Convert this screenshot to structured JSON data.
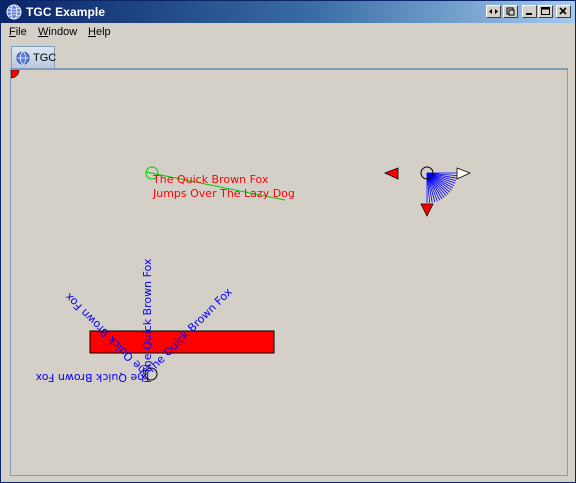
{
  "window": {
    "title": "TGC Example",
    "title_icon": "globe-icon"
  },
  "titlebar_buttons": [
    "pin-icon",
    "restore-small-icon",
    "minimize-icon",
    "maximize-icon",
    "close-icon"
  ],
  "menu": {
    "file": "File",
    "file_rest": "ile",
    "window": "Window",
    "window_rest": "indow",
    "help": "Help",
    "help_rest": "elp"
  },
  "tab": {
    "label": "TGC",
    "icon": "globe-icon"
  },
  "canvas": {
    "text1_line1": "The Quick Brown Fox",
    "text1_line2": "Jumps Over The Lazy Dog",
    "rotated_text": "The Quick Brown Fox",
    "colors": {
      "red": "#ff0000",
      "blue": "#0000ff",
      "green": "#00cc00",
      "black": "#000000"
    }
  }
}
